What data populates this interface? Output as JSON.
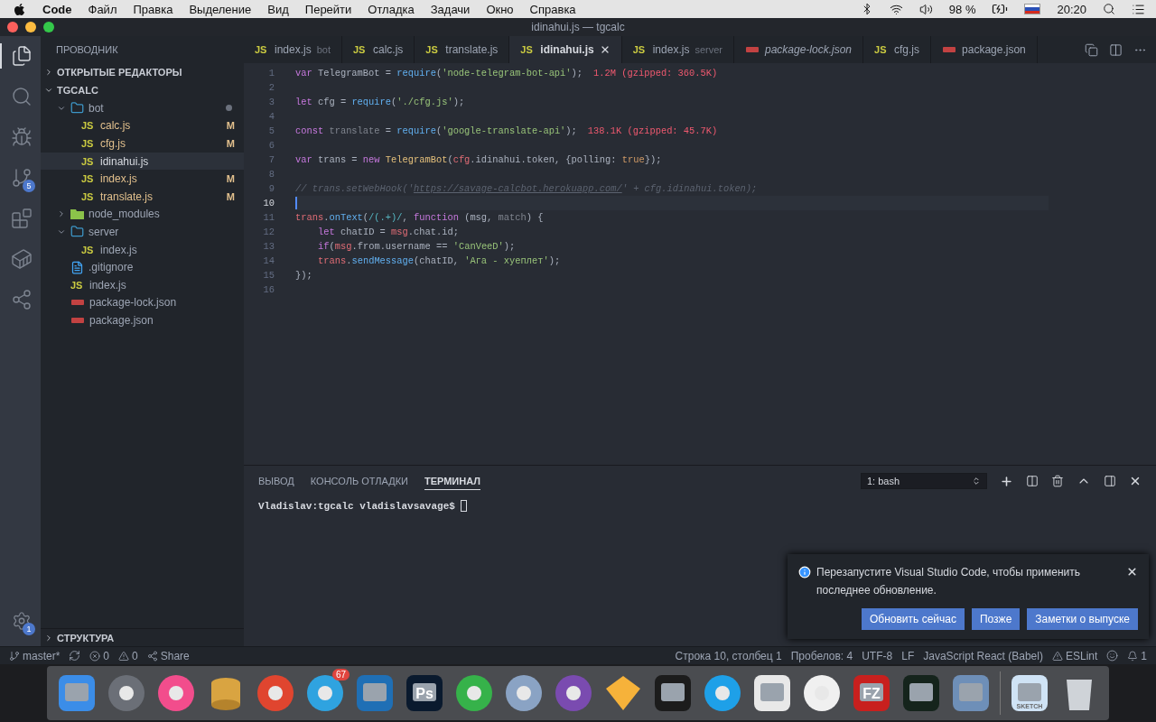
{
  "menu_bar": {
    "app": "Code",
    "items": [
      "Файл",
      "Правка",
      "Выделение",
      "Вид",
      "Перейти",
      "Отладка",
      "Задачи",
      "Окно",
      "Справка"
    ],
    "battery": "98 %",
    "time": "20:20"
  },
  "window": {
    "title": "idinahui.js — tgcalc"
  },
  "activity_bar": {
    "items": [
      {
        "kind": "files",
        "selected": true
      },
      {
        "kind": "search",
        "selected": false
      },
      {
        "kind": "debug",
        "selected": false
      },
      {
        "kind": "git",
        "selected": false,
        "badge": "5"
      },
      {
        "kind": "extensions",
        "selected": false
      },
      {
        "kind": "docker",
        "selected": false
      },
      {
        "kind": "share",
        "selected": false
      }
    ],
    "settings_badge": "1"
  },
  "sidebar": {
    "title": "ПРОВОДНИК",
    "sections": [
      {
        "label": "ОТКРЫТЫЕ РЕДАКТОРЫ",
        "expanded": false
      },
      {
        "label": "TGCALC",
        "expanded": true
      }
    ],
    "tree": [
      {
        "name": "bot",
        "kind": "folder",
        "expanded": true,
        "selected": false,
        "dot": true,
        "children": [
          {
            "name": "calc.js",
            "kind": "js",
            "icon": "JS",
            "status": "M",
            "selected": false
          },
          {
            "name": "cfg.js",
            "kind": "js",
            "icon": "JS",
            "status": "M",
            "selected": false
          },
          {
            "name": "idinahui.js",
            "kind": "js",
            "icon": "JS",
            "selected": true
          },
          {
            "name": "index.js",
            "kind": "js",
            "icon": "JS",
            "status": "M",
            "selected": false
          },
          {
            "name": "translate.js",
            "kind": "js",
            "icon": "JS",
            "status": "M",
            "selected": false
          }
        ]
      },
      {
        "name": "node_modules",
        "kind": "node-folder",
        "expanded": false,
        "selected": false
      },
      {
        "name": "server",
        "kind": "folder",
        "expanded": true,
        "selected": false,
        "children": [
          {
            "name": "index.js",
            "kind": "js",
            "icon": "JS",
            "selected": false
          }
        ]
      },
      {
        "name": ".gitignore",
        "kind": "file",
        "selected": false
      },
      {
        "name": "index.js",
        "kind": "js",
        "icon": "JS",
        "selected": false
      },
      {
        "name": "package-lock.json",
        "kind": "json",
        "selected": false
      },
      {
        "name": "package.json",
        "kind": "json",
        "selected": false
      }
    ],
    "outline": {
      "label": "СТРУКТУРА",
      "expanded": false
    }
  },
  "tabs": [
    {
      "label": "index.js",
      "hint": "bot",
      "kind": "js",
      "icon": "JS",
      "selected": false,
      "preview": false
    },
    {
      "label": "calc.js",
      "kind": "js",
      "icon": "JS",
      "selected": false,
      "preview": false
    },
    {
      "label": "translate.js",
      "kind": "js",
      "icon": "JS",
      "selected": false,
      "preview": false
    },
    {
      "label": "idinahui.js",
      "kind": "js",
      "icon": "JS",
      "selected": true,
      "preview": false
    },
    {
      "label": "index.js",
      "hint": "server",
      "kind": "js",
      "icon": "JS",
      "selected": false,
      "preview": false
    },
    {
      "label": "package-lock.json",
      "kind": "json",
      "selected": false,
      "preview": true
    },
    {
      "label": "cfg.js",
      "kind": "js",
      "icon": "JS",
      "selected": false,
      "preview": false
    },
    {
      "label": "package.json",
      "kind": "json",
      "selected": false,
      "preview": false
    }
  ],
  "editor": {
    "lines": [
      {
        "number": "1",
        "current": false,
        "tokens": [
          {
            "kind": "keyword",
            "text": "var"
          },
          {
            "kind": "plain",
            "text": " TelegramBot = "
          },
          {
            "kind": "function",
            "text": "require"
          },
          {
            "kind": "plain",
            "text": "("
          },
          {
            "kind": "string",
            "text": "'node-telegram-bot-api'"
          },
          {
            "kind": "plain",
            "text": ");"
          }
        ],
        "annotation": "1.2M (gzipped: 360.5K)"
      },
      {
        "number": "2",
        "current": false
      },
      {
        "number": "3",
        "current": false,
        "tokens": [
          {
            "kind": "keyword",
            "text": "let"
          },
          {
            "kind": "plain",
            "text": " cfg = "
          },
          {
            "kind": "function",
            "text": "require"
          },
          {
            "kind": "plain",
            "text": "("
          },
          {
            "kind": "string",
            "text": "'./cfg.js'"
          },
          {
            "kind": "plain",
            "text": ");"
          }
        ]
      },
      {
        "number": "4",
        "current": false
      },
      {
        "number": "5",
        "current": false,
        "tokens": [
          {
            "kind": "keyword",
            "text": "const"
          },
          {
            "kind": "unused",
            "text": " translate"
          },
          {
            "kind": "plain",
            "text": " = "
          },
          {
            "kind": "function",
            "text": "require"
          },
          {
            "kind": "plain",
            "text": "("
          },
          {
            "kind": "string",
            "text": "'google-translate-api'"
          },
          {
            "kind": "plain",
            "text": ");"
          }
        ],
        "annotation": "138.1K (gzipped: 45.7K)"
      },
      {
        "number": "6",
        "current": false
      },
      {
        "number": "7",
        "current": false,
        "tokens": [
          {
            "kind": "keyword",
            "text": "var"
          },
          {
            "kind": "plain",
            "text": " trans = "
          },
          {
            "kind": "keyword",
            "text": "new "
          },
          {
            "kind": "class",
            "text": "TelegramBot"
          },
          {
            "kind": "plain",
            "text": "("
          },
          {
            "kind": "variable",
            "text": "cfg"
          },
          {
            "kind": "plain",
            "text": ".idinahui.token, {polling: "
          },
          {
            "kind": "constant",
            "text": "true"
          },
          {
            "kind": "plain",
            "text": "});"
          }
        ]
      },
      {
        "number": "8",
        "current": false
      },
      {
        "number": "9",
        "current": false,
        "tokens": [
          {
            "kind": "comment",
            "text": "// trans.setWebHook('"
          },
          {
            "kind": "link",
            "text": "https://savage-calcbot.herokuapp.com/"
          },
          {
            "kind": "comment",
            "text": "' + cfg.idinahui.token);"
          }
        ]
      },
      {
        "number": "10",
        "current": true
      },
      {
        "number": "11",
        "current": false,
        "tokens": [
          {
            "kind": "variable",
            "text": "trans"
          },
          {
            "kind": "plain",
            "text": "."
          },
          {
            "kind": "function",
            "text": "onText"
          },
          {
            "kind": "plain",
            "text": "("
          },
          {
            "kind": "regex",
            "text": "/(.+)/"
          },
          {
            "kind": "plain",
            "text": ", "
          },
          {
            "kind": "keyword",
            "text": "function"
          },
          {
            "kind": "plain",
            "text": " (msg, "
          },
          {
            "kind": "unused",
            "text": "match"
          },
          {
            "kind": "plain",
            "text": ") {"
          }
        ]
      },
      {
        "number": "12",
        "current": false,
        "indent": true,
        "tokens": [
          {
            "kind": "keyword",
            "text": "let"
          },
          {
            "kind": "plain",
            "text": " chatID = "
          },
          {
            "kind": "variable",
            "text": "msg"
          },
          {
            "kind": "plain",
            "text": ".chat.id;"
          }
        ]
      },
      {
        "number": "13",
        "current": false,
        "indent": true,
        "tokens": [
          {
            "kind": "keyword",
            "text": "if"
          },
          {
            "kind": "plain",
            "text": "("
          },
          {
            "kind": "variable",
            "text": "msg"
          },
          {
            "kind": "plain",
            "text": ".from.username == "
          },
          {
            "kind": "string",
            "text": "'CanVeeD'"
          },
          {
            "kind": "plain",
            "text": ");"
          }
        ]
      },
      {
        "number": "14",
        "current": false,
        "indent": true,
        "tokens": [
          {
            "kind": "variable",
            "text": "trans"
          },
          {
            "kind": "plain",
            "text": "."
          },
          {
            "kind": "function",
            "text": "sendMessage"
          },
          {
            "kind": "plain",
            "text": "(chatID, "
          },
          {
            "kind": "string",
            "text": "'Ага - хуеплет'"
          },
          {
            "kind": "plain",
            "text": ");"
          }
        ]
      },
      {
        "number": "15",
        "current": false,
        "tokens": [
          {
            "kind": "plain",
            "text": "});"
          }
        ]
      },
      {
        "number": "16",
        "current": false
      }
    ]
  },
  "panel": {
    "tabs": [
      {
        "label": "ВЫВОД",
        "selected": false
      },
      {
        "label": "КОНСОЛЬ ОТЛАДКИ",
        "selected": false
      },
      {
        "label": "ТЕРМИНАЛ",
        "selected": true
      }
    ],
    "terminal_select": "1: bash",
    "prompt": "Vladislav:tgcalc vladislavsavage$ "
  },
  "notification": {
    "message": "Перезапустите Visual Studio Code, чтобы применить последнее обновление.",
    "buttons": [
      "Обновить сейчас",
      "Позже",
      "Заметки о выпуске"
    ]
  },
  "status_bar": {
    "left": [
      {
        "kind": "branch",
        "text": "master*"
      },
      {
        "kind": "sync"
      },
      {
        "kind": "errors",
        "text": "0"
      },
      {
        "kind": "warnings",
        "text": "0"
      },
      {
        "kind": "share",
        "text": "Share"
      }
    ],
    "right": [
      {
        "kind": "text",
        "text": "Строка 10, столбец 1"
      },
      {
        "kind": "text",
        "text": "Пробелов: 4"
      },
      {
        "kind": "text",
        "text": "UTF-8"
      },
      {
        "kind": "text",
        "text": "LF"
      },
      {
        "kind": "text",
        "text": "JavaScript React (Babel)"
      },
      {
        "kind": "eslint",
        "text": "ESLint"
      },
      {
        "kind": "feedback"
      },
      {
        "kind": "bell",
        "text": "1"
      }
    ]
  },
  "dock": {
    "apps": [
      {
        "kind": "finder",
        "color": "#3b8de8"
      },
      {
        "kind": "launchpad",
        "color": "#6b6f77"
      },
      {
        "kind": "music",
        "color": "#f24d8c"
      },
      {
        "kind": "database",
        "color": "#d9a441"
      },
      {
        "kind": "browser",
        "color": "#e0452f"
      },
      {
        "kind": "messenger",
        "color": "#2fa3e0",
        "badge": "67"
      },
      {
        "kind": "editor",
        "color": "#1f6fb5"
      },
      {
        "kind": "photo-editor",
        "color": "#0a1a2e",
        "label": "Ps"
      },
      {
        "kind": "notes",
        "color": "#36b24a"
      },
      {
        "kind": "mail",
        "color": "#8aa3c4"
      },
      {
        "kind": "git-client",
        "color": "#7a4bb0"
      },
      {
        "kind": "design",
        "color": "#f6b23a"
      },
      {
        "kind": "terminal",
        "color": "#1c1c1c"
      },
      {
        "kind": "chat",
        "color": "#1ea0e8"
      },
      {
        "kind": "team-chat",
        "color": "#e8e8e8"
      },
      {
        "kind": "db-client",
        "color": "#f0f0f0"
      },
      {
        "kind": "ftp",
        "color": "#c8201e",
        "label": "FZ"
      },
      {
        "kind": "monitor",
        "color": "#15241c"
      },
      {
        "kind": "viewer",
        "color": "#6e8fb8"
      },
      {
        "kind": "document",
        "color": "#cfe3f5",
        "label": "SKETCH"
      },
      {
        "kind": "trash",
        "color": "#cfd3d8"
      }
    ]
  }
}
